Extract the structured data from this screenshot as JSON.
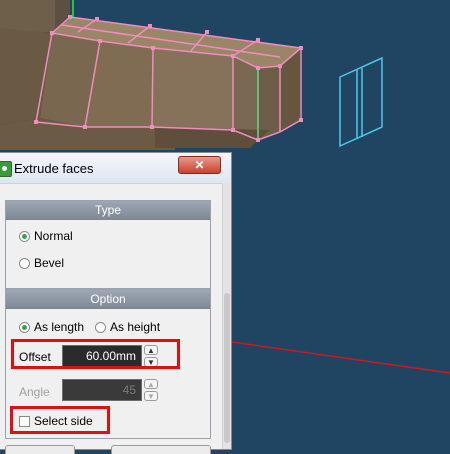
{
  "dialog": {
    "title": "Extrude faces",
    "close_icon": "close-x-icon",
    "type_group": {
      "header": "Type",
      "options": [
        "Normal",
        "Bevel"
      ],
      "selected": "Normal"
    },
    "option_group": {
      "header": "Option",
      "modes": [
        "As length",
        "As height"
      ],
      "selected_mode": "As length",
      "offset_label": "Offset",
      "offset_value": "60.00mm",
      "angle_label": "Angle",
      "angle_value": "45",
      "select_side_label": "Select side",
      "select_side_checked": false
    }
  },
  "colors": {
    "viewport_bg": "#1f4563",
    "model_face": "#7d6a50",
    "edge_highlight": "#f08cbf",
    "accent_green": "#62d98a",
    "callout_red": "#e01010"
  }
}
